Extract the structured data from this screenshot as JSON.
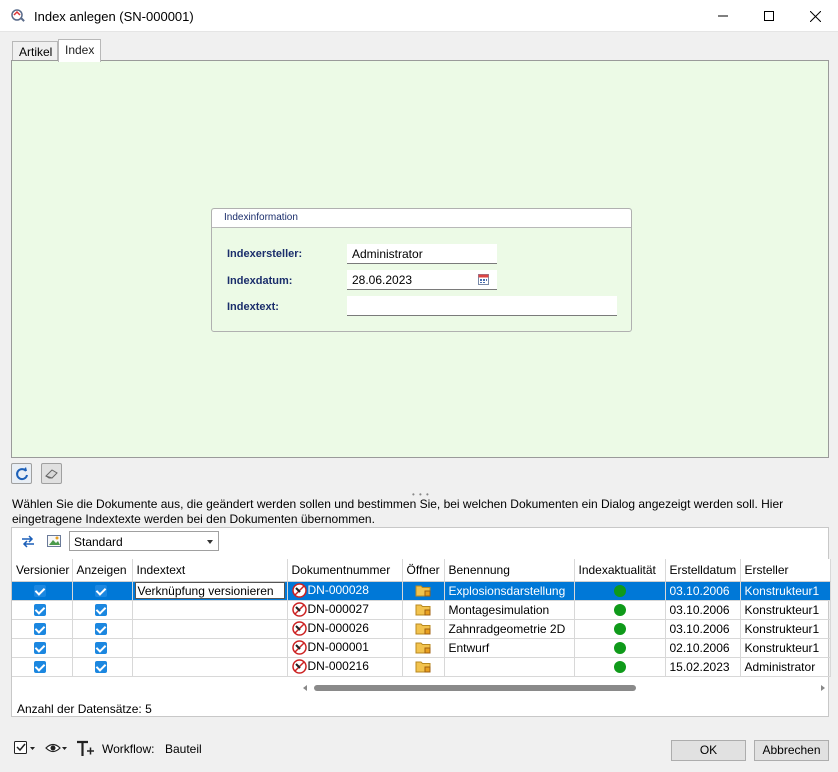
{
  "window": {
    "title": "Index anlegen (SN-000001)"
  },
  "tabs": [
    {
      "label": "Artikel"
    },
    {
      "label": "Index"
    }
  ],
  "group": {
    "header": "Indexinformation",
    "creator_label": "Indexersteller:",
    "creator_value": "Administrator",
    "date_label": "Indexdatum:",
    "date_value": "28.06.2023",
    "text_label": "Indextext:",
    "text_value": ""
  },
  "info_text": "Wählen Sie die Dokumente aus, die geändert werden sollen und bestimmen Sie, bei welchen Dokumenten ein Dialog angezeigt werden soll. Hier eingetragene Indextexte werden bei den Dokumenten übernommen.",
  "view_combo": "Standard",
  "columns": [
    "Versionier",
    "Anzeigen",
    "Indextext",
    "Dokumentnummer",
    "Öffner",
    "Benennung",
    "Indexaktualität",
    "Erstelldatum",
    "Ersteller"
  ],
  "rows": [
    {
      "versionieren": true,
      "anzeigen": true,
      "indextext": "Verknüpfung versionieren",
      "docnum": "DN-000028",
      "benennung": "Explosionsdarstellung",
      "aktualitaet": "green",
      "datum": "03.10.2006",
      "ersteller": "Konstrukteur1",
      "selected": true
    },
    {
      "versionieren": true,
      "anzeigen": true,
      "indextext": "",
      "docnum": "DN-000027",
      "benennung": "Montagesimulation",
      "aktualitaet": "green",
      "datum": "03.10.2006",
      "ersteller": "Konstrukteur1",
      "selected": false
    },
    {
      "versionieren": true,
      "anzeigen": true,
      "indextext": "",
      "docnum": "DN-000026",
      "benennung": "Zahnradgeometrie 2D",
      "aktualitaet": "green",
      "datum": "03.10.2006",
      "ersteller": "Konstrukteur1",
      "selected": false
    },
    {
      "versionieren": true,
      "anzeigen": true,
      "indextext": "",
      "docnum": "DN-000001",
      "benennung": "Entwurf",
      "aktualitaet": "green",
      "datum": "02.10.2006",
      "ersteller": "Konstrukteur1",
      "selected": false
    },
    {
      "versionieren": true,
      "anzeigen": true,
      "indextext": "",
      "docnum": "DN-000216",
      "benennung": "",
      "aktualitaet": "green",
      "datum": "15.02.2023",
      "ersteller": "Administrator",
      "selected": false
    }
  ],
  "record_count": "Anzahl der Datensätze: 5",
  "bottom": {
    "workflow_label": "Workflow:",
    "workflow_value": "Bauteil"
  },
  "buttons": {
    "ok": "OK",
    "cancel": "Abbrechen"
  },
  "colors": {
    "selection": "#0078d7",
    "form_background": "#ecfae6",
    "status_green": "#0f9a1a",
    "label_blue": "#1a2d6b"
  }
}
